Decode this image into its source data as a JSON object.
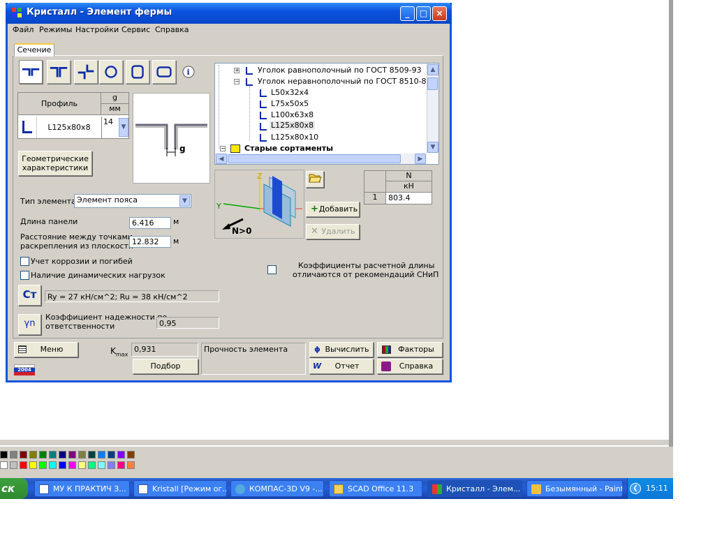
{
  "window": {
    "title": "Кристалл - Элемент фермы",
    "minimize": "_",
    "maximize": "□",
    "close": "×"
  },
  "menu": [
    "Файл",
    "Режимы",
    "Настройки",
    "Сервис",
    "Справка"
  ],
  "tab": "Сечение",
  "profile_table": {
    "col_profile": "Профиль",
    "col_g": "g",
    "col_g_unit": "мм",
    "profile_value": "L125x80x8",
    "g_value": "14"
  },
  "diagram_g_label": "g",
  "geom_button": "Геометрические характеристики",
  "tree": {
    "items": [
      {
        "text": "Уголок равнополочный по ГОСТ 8509-93"
      },
      {
        "text": "Уголок неравнополочный по ГОСТ 8510-86*"
      },
      {
        "text": "L50x32x4"
      },
      {
        "text": "L75x50x5"
      },
      {
        "text": "L100x63x8"
      },
      {
        "text": "L125x80x8"
      },
      {
        "text": "L125x80x10"
      },
      {
        "text": "Старые сортаменты"
      }
    ]
  },
  "element_type": {
    "label": "Тип элемента",
    "value": "Элемент пояса"
  },
  "panel_length": {
    "label": "Длина панели",
    "value": "6.416",
    "unit": "м"
  },
  "brace_distance": {
    "label_line1": "Расстояние между точками",
    "label_line2": "раскрепления из плоскости",
    "value": "12.832",
    "unit": "м"
  },
  "check_corrosion": "Учет коррозии и погибей",
  "check_dynamic": "Наличие динамических нагрузок",
  "check_coef": {
    "line1": "Коэффициенты расчетной длины",
    "line2": "отличаются от рекомендаций СНиП"
  },
  "steel": {
    "button": "Ст",
    "value": "Ry = 27 кН/см^2; Ru = 38 кН/см^2"
  },
  "reliability": {
    "label_line1": "Коэффициент надежности по",
    "label_line2": "ответственности",
    "value": "0,95",
    "symbol": "γn"
  },
  "axes": {
    "z": "Z",
    "y": "Y",
    "n": "N>0"
  },
  "load_table": {
    "col": "N",
    "unit": "кН",
    "row_num": "1",
    "value": "803.4"
  },
  "buttons": {
    "add": "Добавить",
    "delete": "Удалить",
    "menu": "Меню",
    "select": "Подбор",
    "calculate": "Вычислить",
    "report": "Отчет",
    "factors": "Факторы",
    "help": "Справка"
  },
  "kmax": {
    "label_main": "K",
    "label_sub": "max",
    "label_eq": " =",
    "value": "0,931"
  },
  "strength_label": "Прочность элемента",
  "logo_year": "2004",
  "palette": [
    "#000000",
    "#808080",
    "#800000",
    "#808000",
    "#008000",
    "#008080",
    "#000080",
    "#800080",
    "#808040",
    "#004040",
    "#0080ff",
    "#004080",
    "#8000ff",
    "#804000",
    "#ffffff",
    "#c0c0c0",
    "#ff0000",
    "#ffff00",
    "#00ff00",
    "#00ffff",
    "#0000ff",
    "#ff00ff",
    "#ffff80",
    "#00ff80",
    "#80ffff",
    "#8080ff",
    "#ff0080",
    "#ff8040"
  ],
  "taskbar": {
    "start": "ск",
    "tasks": [
      "МУ К ПРАКТИЧ З...",
      "Kristall [Режим ог...",
      "КОМПАС-3D V9 -...",
      "SCAD Office 11.3",
      "Кристалл - Элем...",
      "Безымянный - Paint"
    ],
    "clock": "15:11"
  }
}
